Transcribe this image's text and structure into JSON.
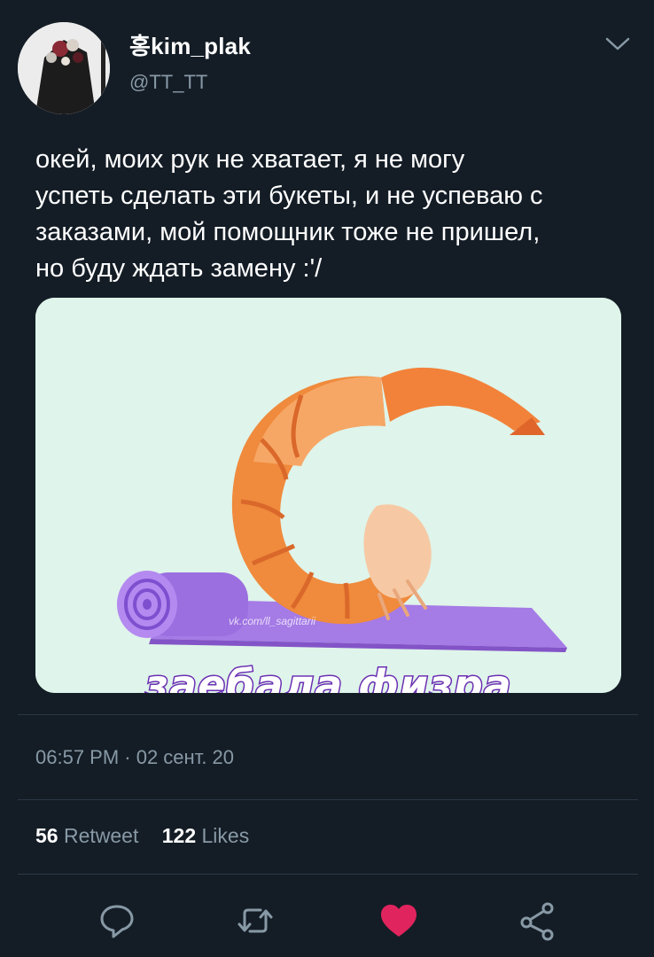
{
  "author": {
    "display_name": "홍kim_plak",
    "handle": "@TT_TT"
  },
  "tweet": {
    "text": "окей, моих рук не хватает, я не могу\nуспеть сделать эти букеты, и не успеваю с\nзаказами, мой помощник тоже не пришел,\nно буду ждать замену :'/"
  },
  "media": {
    "caption": "заебала физра",
    "watermark": "vk.com/ll_sagittarii",
    "colors": {
      "background": "#dff4ea",
      "mat": "#9b6fe0",
      "shrimp": "#f08a3c"
    }
  },
  "meta": {
    "timestamp": "06:57 PM · 02 сент. 20"
  },
  "stats": {
    "retweets_count": "56",
    "retweets_label": "Retweet",
    "likes_count": "122",
    "likes_label": "Likes"
  },
  "actions": {
    "icons": [
      "reply-icon",
      "retweet-icon",
      "like-icon",
      "share-icon"
    ],
    "like_color": "#e0245e",
    "muted_color": "#8899a6"
  }
}
